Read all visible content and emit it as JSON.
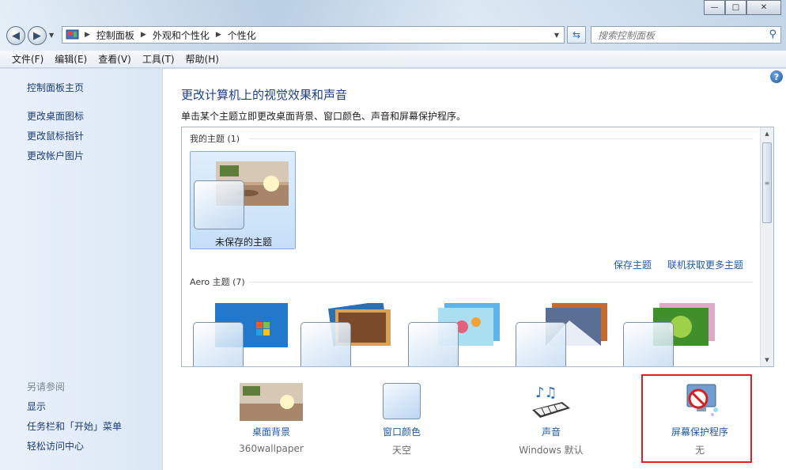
{
  "window": {
    "minimize_glyph": "—",
    "maximize_glyph": "□",
    "close_glyph": "✕"
  },
  "addressbar": {
    "segments": [
      "控制面板",
      "外观和个性化",
      "个性化"
    ],
    "search_placeholder": "搜索控制面板"
  },
  "menu": [
    "文件(F)",
    "编辑(E)",
    "查看(V)",
    "工具(T)",
    "帮助(H)"
  ],
  "sidebar": {
    "home": "控制面板主页",
    "links": [
      "更改桌面图标",
      "更改鼠标指针",
      "更改帐户图片"
    ],
    "seealso_title": "另请参阅",
    "seealso": [
      "显示",
      "任务栏和「开始」菜单",
      "轻松访问中心"
    ]
  },
  "main": {
    "title": "更改计算机上的视觉效果和声音",
    "subtitle": "单击某个主题立即更改桌面背景、窗口颜色、声音和屏幕保护程序。",
    "help_glyph": "?",
    "my_themes_header": "我的主题 (1)",
    "unsaved_theme": "未保存的主题",
    "save_theme": "保存主题",
    "get_more": "联机获取更多主题",
    "aero_header": "Aero 主题 (7)"
  },
  "bottom": [
    {
      "label": "桌面背景",
      "value": "360wallpaper",
      "icon": "wallpaper-icon"
    },
    {
      "label": "窗口颜色",
      "value": "天空",
      "icon": "window-color-icon"
    },
    {
      "label": "声音",
      "value": "Windows 默认",
      "icon": "sound-icon"
    },
    {
      "label": "屏幕保护程序",
      "value": "无",
      "icon": "screensaver-icon"
    }
  ],
  "colors": {
    "link": "#1e5aa8",
    "title": "#1e3f8a",
    "selection": "#c6dff7",
    "highlight_box": "#e02020"
  }
}
